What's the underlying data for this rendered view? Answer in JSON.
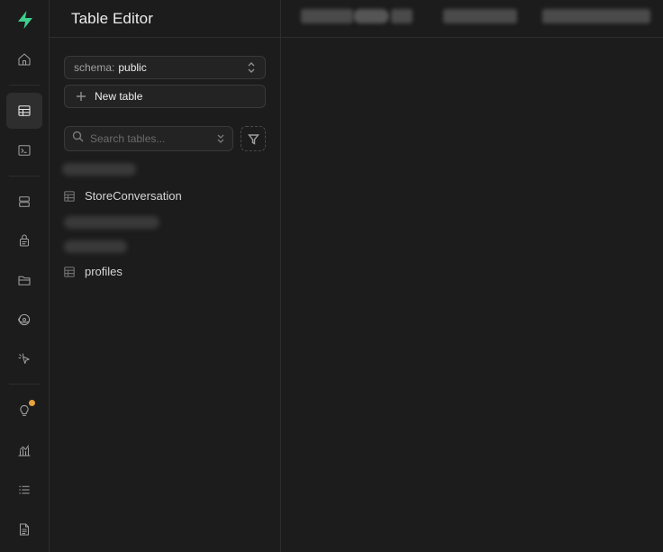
{
  "header": {
    "title": "Table Editor"
  },
  "nav": {
    "items": [
      {
        "name": "home-icon"
      },
      {
        "name": "table-editor-icon",
        "active": true
      },
      {
        "name": "sql-editor-icon"
      },
      {
        "name": "database-icon"
      },
      {
        "name": "auth-icon"
      },
      {
        "name": "storage-icon"
      },
      {
        "name": "realtime-icon"
      },
      {
        "name": "edge-functions-icon"
      },
      {
        "name": "advisors-icon",
        "badge": true
      },
      {
        "name": "reports-icon"
      },
      {
        "name": "logs-icon"
      },
      {
        "name": "api-docs-icon"
      }
    ],
    "accent_color": "#3ecf8e",
    "badge_color": "#e8a33c"
  },
  "sidebar": {
    "schema_label": "schema:",
    "schema_value": "public",
    "new_table_label": "New table",
    "search_placeholder": "Search tables...",
    "tables": [
      {
        "label": "StoreConversation"
      },
      {
        "label": "profiles"
      }
    ]
  }
}
